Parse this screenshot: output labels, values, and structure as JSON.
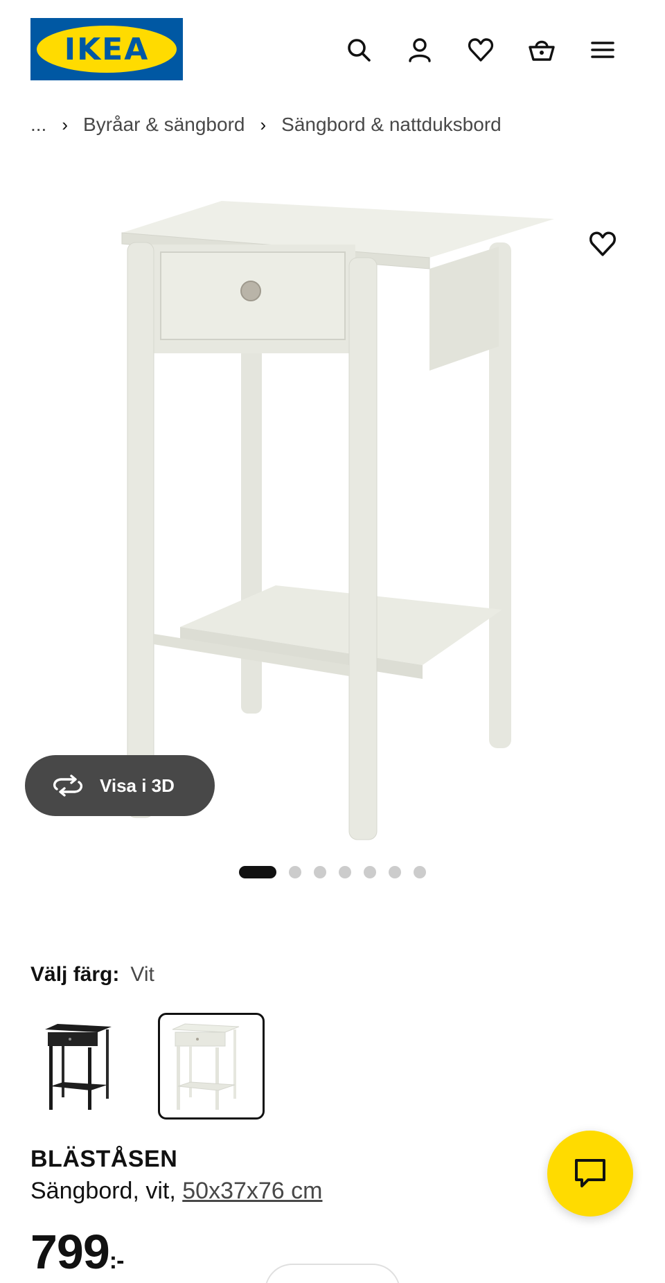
{
  "header": {
    "logo_text": "IKEA",
    "logo_reg": "®",
    "icons": [
      "search-icon",
      "account-icon",
      "favourites-icon",
      "basket-icon",
      "menu-icon"
    ],
    "brand_blue": "#0058a3",
    "brand_yellow": "#ffdb00"
  },
  "breadcrumb": {
    "items": [
      "...",
      "Byråar & sängbord",
      "Sängbord & nattduksbord"
    ],
    "separator": "›"
  },
  "gallery": {
    "view_3d_label": "Visa i 3D",
    "image_count": 7,
    "active_index": 0
  },
  "color_choice": {
    "label": "Välj färg:",
    "selected_value": "Vit",
    "swatches": [
      {
        "name": "black",
        "color": "#1c1c1c",
        "selected": false
      },
      {
        "name": "white",
        "color": "#e9eae2",
        "selected": true
      }
    ]
  },
  "product": {
    "name": "BLÄSTÅSEN",
    "description_prefix": "Sängbord, vit, ",
    "dimensions": "50x37x76 cm",
    "price_main": "799",
    "price_suffix": ":-"
  },
  "chat": {
    "icon": "chat-icon",
    "color": "#ffdb00"
  }
}
